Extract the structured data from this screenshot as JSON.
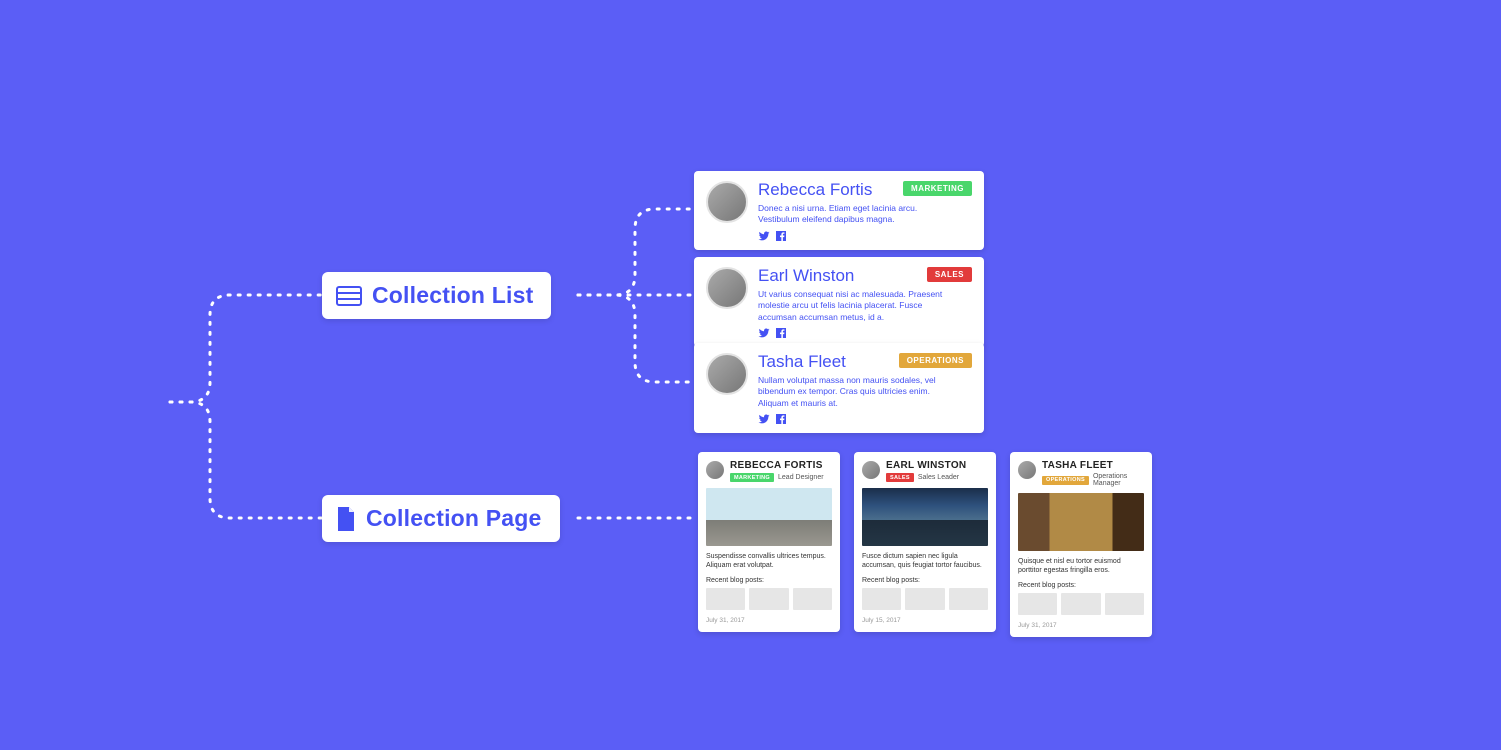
{
  "labels": {
    "collection_list": "Collection List",
    "collection_page": "Collection Page"
  },
  "list": [
    {
      "name": "Rebecca Fortis",
      "desc": "Donec a nisi urna. Etiam eget lacinia arcu. Vestibulum eleifend dapibus magna.",
      "badge": {
        "text": "MARKETING",
        "color": "#49D66B"
      }
    },
    {
      "name": "Earl Winston",
      "desc": "Ut varius consequat nisi ac malesuada. Praesent molestie arcu ut felis lacinia placerat. Fusce accumsan accumsan metus, id a.",
      "badge": {
        "text": "SALES",
        "color": "#E23B3B"
      }
    },
    {
      "name": "Tasha Fleet",
      "desc": "Nullam volutpat massa non mauris sodales, vel bibendum ex tempor. Cras quis ultricies enim. Aliquam et mauris at.",
      "badge": {
        "text": "OPERATIONS",
        "color": "#E2A73B"
      }
    }
  ],
  "pages": [
    {
      "name": "REBECCA FORTIS",
      "badge": {
        "text": "MARKETING",
        "color": "#49D66B"
      },
      "role": "Lead Designer",
      "summary": "Suspendisse convallis ultrices tempus. Aliquam erat volutpat.",
      "recent_label": "Recent blog posts:",
      "date": "July 31, 2017"
    },
    {
      "name": "EARL WINSTON",
      "badge": {
        "text": "SALES",
        "color": "#E23B3B"
      },
      "role": "Sales Leader",
      "summary": "Fusce dictum sapien nec ligula accumsan, quis feugiat tortor faucibus.",
      "recent_label": "Recent blog posts:",
      "date": "July 15, 2017"
    },
    {
      "name": "TASHA FLEET",
      "badge": {
        "text": "OPERATIONS",
        "color": "#E2A73B"
      },
      "role": "Operations Manager",
      "summary": "Quisque et nisl eu tortor euismod porttitor egestas fringilla eros.",
      "recent_label": "Recent blog posts:",
      "date": "July 31, 2017"
    }
  ]
}
